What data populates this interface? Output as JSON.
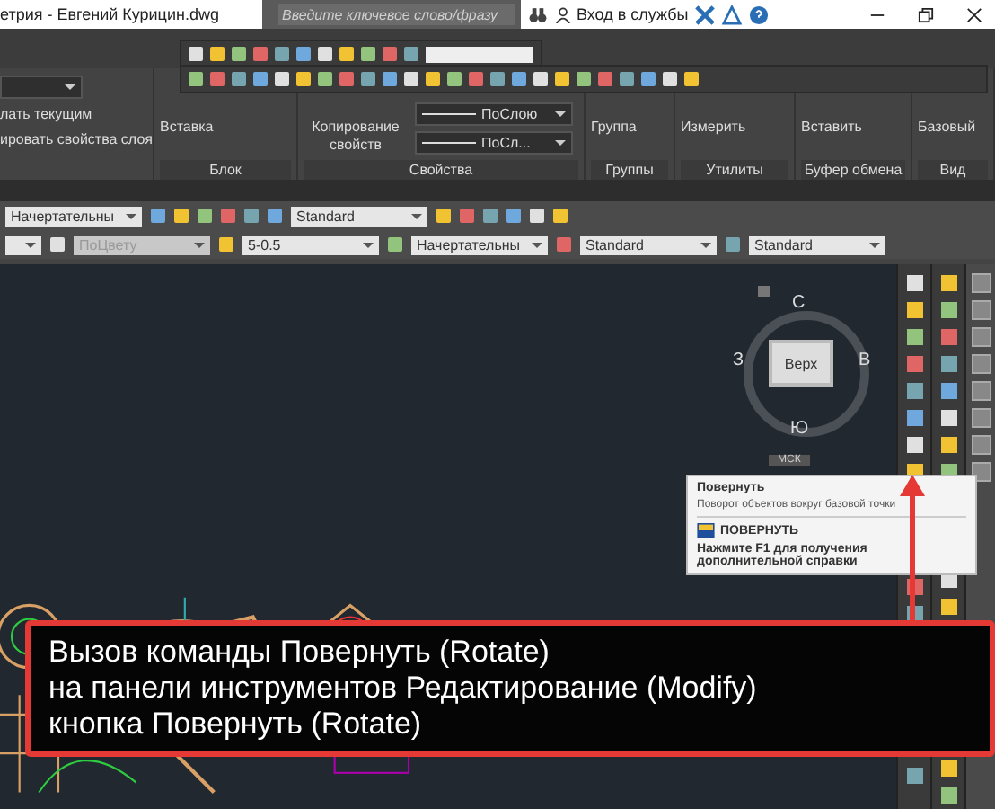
{
  "title_bar": {
    "title": "етрия - Евгений Курицин.dwg",
    "search_placeholder": "Введите ключевое слово/фразу",
    "sign_in": "Вход в службы"
  },
  "ribbon": {
    "layer_texts": [
      "лать текущим",
      "ировать свойства слоя"
    ],
    "panels": [
      {
        "label": "Блок",
        "items": [
          {
            "kind": "large",
            "label": "Вставка"
          }
        ]
      },
      {
        "label": "Свойства",
        "items": [
          {
            "kind": "large",
            "label": "Копирование свойств"
          },
          {
            "kind": "combo",
            "label": "ПоСлою"
          },
          {
            "kind": "combo",
            "label": "ПоСл..."
          }
        ]
      },
      {
        "label": "Группы",
        "items": [
          {
            "kind": "large",
            "label": "Группа"
          }
        ]
      },
      {
        "label": "Утилиты",
        "items": [
          {
            "kind": "large",
            "label": "Измерить"
          }
        ]
      },
      {
        "label": "Буфер обмена",
        "items": [
          {
            "kind": "large",
            "label": "Вставить"
          }
        ]
      },
      {
        "label": "Вид",
        "items": [
          {
            "kind": "large",
            "label": "Базовый"
          }
        ]
      }
    ]
  },
  "toolbar_rows": [
    [
      {
        "kind": "combo",
        "value": "Начертательны",
        "disabled": false
      },
      {
        "kind": "icons"
      },
      {
        "kind": "combo",
        "value": "Standard",
        "disabled": false
      },
      {
        "kind": "icons"
      }
    ],
    [
      {
        "kind": "combo",
        "disabled": false
      },
      {
        "kind": "combo",
        "value": "ПоЦвету",
        "disabled": true
      },
      {
        "kind": "combo",
        "value": "5-0.5",
        "disabled": false
      },
      {
        "kind": "combo",
        "value": "Начертательны",
        "disabled": false
      },
      {
        "kind": "combo",
        "value": "Standard",
        "disabled": false
      },
      {
        "kind": "combo",
        "value": "Standard",
        "disabled": false
      }
    ]
  ],
  "viewcube": {
    "north": "С",
    "west": "З",
    "east": "В",
    "south": "Ю",
    "face": "Верх",
    "ucs": "МСК"
  },
  "tooltip": {
    "title": "Повернуть",
    "description": "Поворот объектов вокруг базовой точки",
    "command": "ПОВЕРНУТЬ",
    "help": "Нажмите F1 для получения дополнительной справки"
  },
  "annotation": {
    "lines": [
      "Вызов команды Повернуть (Rotate)",
      "на панели инструментов Редактирование (Modify)",
      "кнопка Повернуть (Rotate)"
    ]
  }
}
